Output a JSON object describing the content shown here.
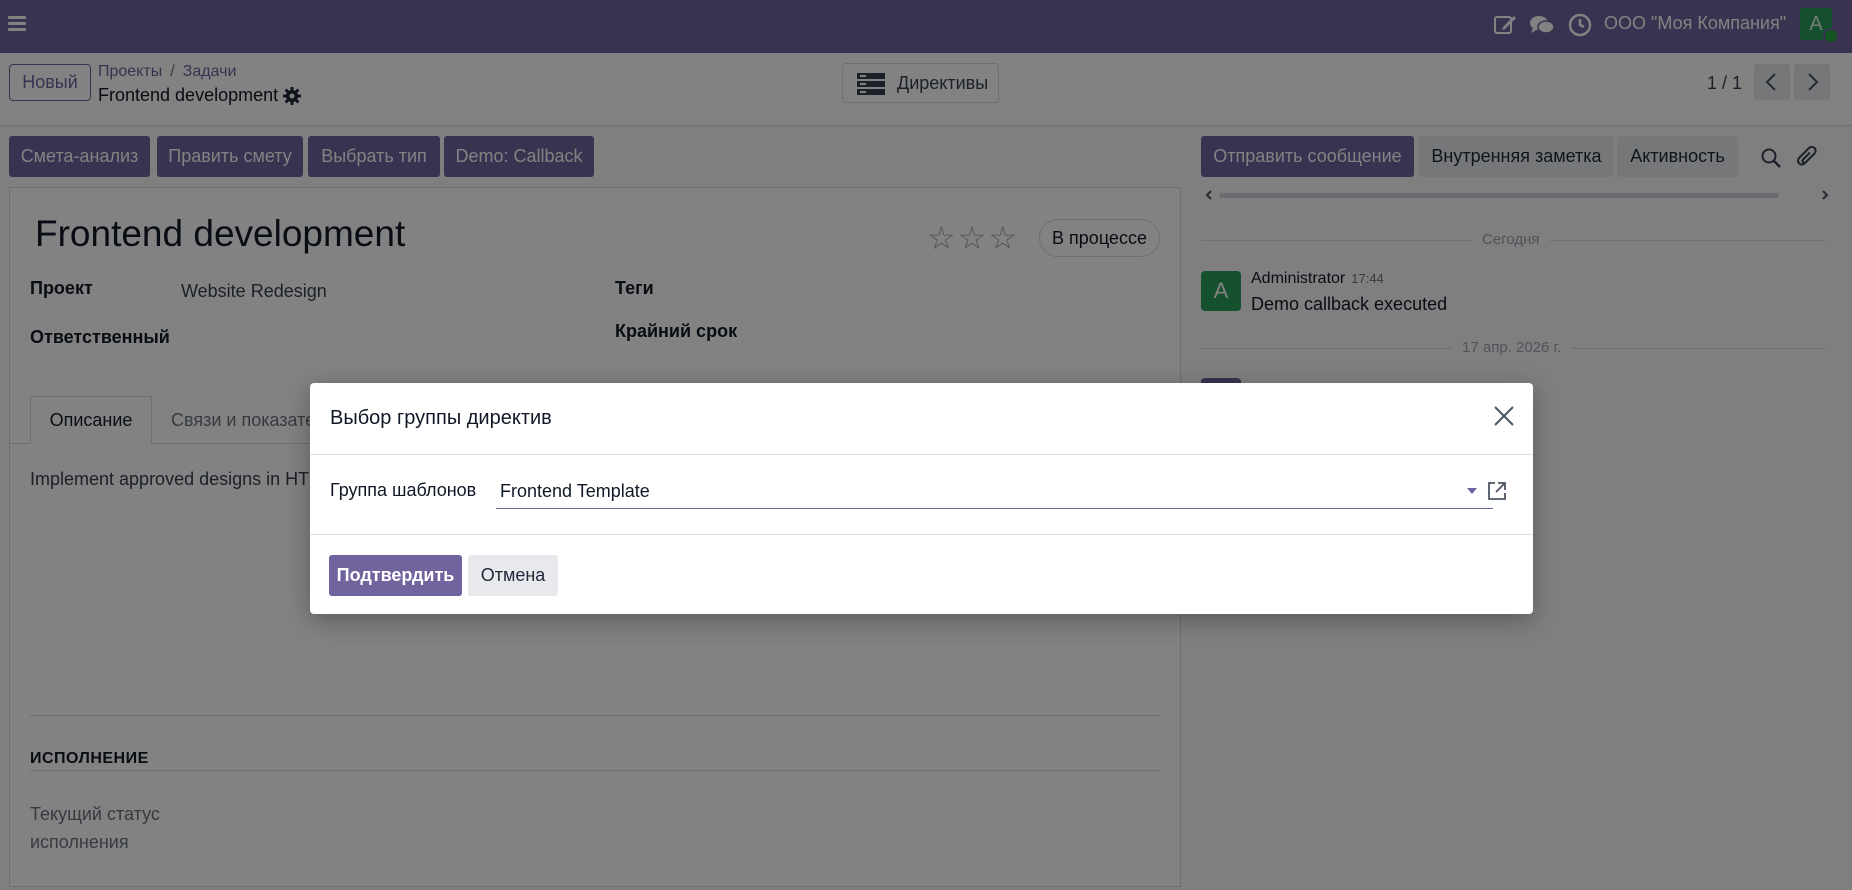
{
  "navbar": {
    "company": "ООО \"Моя Компания\"",
    "avatar_letter": "A",
    "icons": [
      "menu-icon",
      "edit-icon",
      "chat-icon",
      "clock-icon"
    ]
  },
  "control_panel": {
    "new_button": "Новый",
    "breadcrumb": {
      "link1": "Проекты",
      "sep": "/",
      "link2": "Задачи",
      "current": "Frontend development"
    },
    "directives_button": "Директивы",
    "pager": "1 / 1"
  },
  "actions": {
    "estimate_analysis": "Смета-анализ",
    "edit_estimate": "Править смету",
    "choose_type": "Выбрать тип",
    "demo_callback": "Demo: Callback"
  },
  "chatter_buttons": {
    "send_message": "Отправить сообщение",
    "internal_note": "Внутренняя заметка",
    "activity": "Активность"
  },
  "form": {
    "title": "Frontend development",
    "rating_max": 3,
    "rating_value": 0,
    "stage": "В процессе",
    "project_label": "Проект",
    "project_value": "Website Redesign",
    "assignee_label": "Ответственный",
    "tags_label": "Теги",
    "deadline_label": "Крайний срок",
    "tabs": [
      "Описание",
      "Связи и показате"
    ],
    "description": "Implement approved designs in HTM",
    "section_title": "ИСПОЛНЕНИЕ",
    "status_label_line1": "Текущий статус",
    "status_label_line2": "исполнения"
  },
  "chatter": {
    "date_today": "Сегодня",
    "message": {
      "avatar": "A",
      "author": "Administrator",
      "time": "17:44",
      "body": "Demo callback executed"
    },
    "date_older": "17 апр. 2026 г."
  },
  "modal": {
    "title": "Выбор группы директив",
    "field_label": "Группа шаблонов",
    "field_value": "Frontend Template",
    "confirm": "Подтвердить",
    "cancel": "Отмена"
  },
  "colors": {
    "brand": "#71639e",
    "avatar_green": "#2a9d5c"
  }
}
